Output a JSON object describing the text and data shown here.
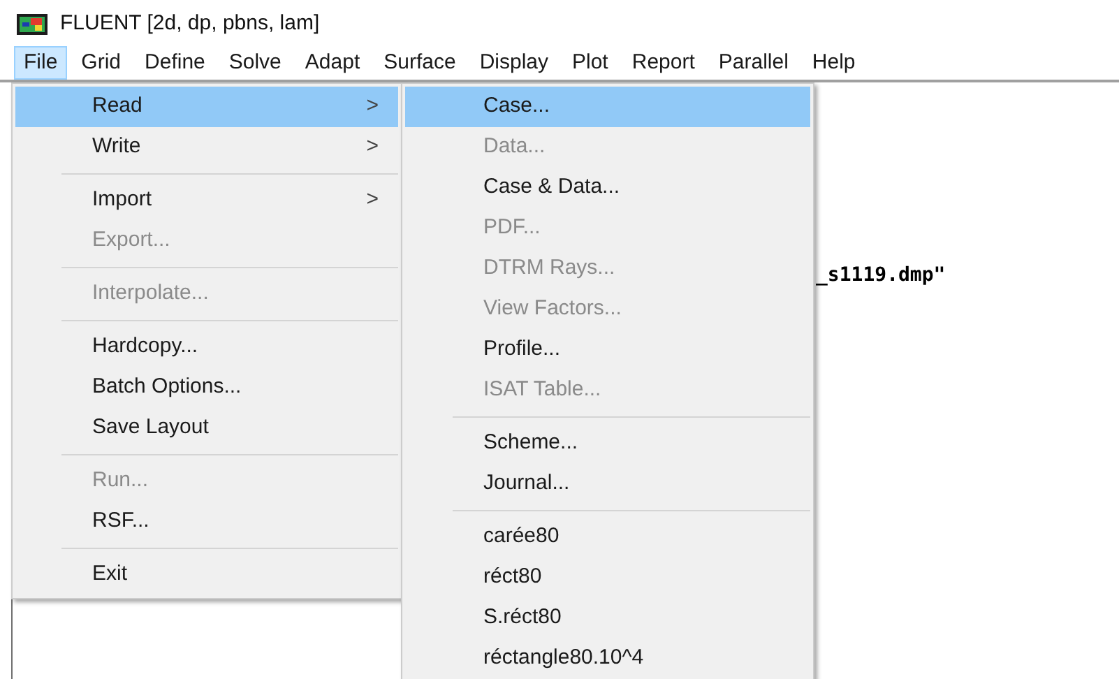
{
  "window": {
    "title": "FLUENT  [2d, dp, pbns, lam]"
  },
  "menubar": [
    {
      "label": "File",
      "selected": true
    },
    {
      "label": "Grid",
      "selected": false
    },
    {
      "label": "Define",
      "selected": false
    },
    {
      "label": "Solve",
      "selected": false
    },
    {
      "label": "Adapt",
      "selected": false
    },
    {
      "label": "Surface",
      "selected": false
    },
    {
      "label": "Display",
      "selected": false
    },
    {
      "label": "Plot",
      "selected": false
    },
    {
      "label": "Report",
      "selected": false
    },
    {
      "label": "Parallel",
      "selected": false
    },
    {
      "label": "Help",
      "selected": false
    }
  ],
  "console": {
    "text": "_s1119.dmp\""
  },
  "file_menu": [
    {
      "kind": "item",
      "label": "Read",
      "submenu": ">",
      "selected": true,
      "disabled": false
    },
    {
      "kind": "item",
      "label": "Write",
      "submenu": ">",
      "selected": false,
      "disabled": false
    },
    {
      "kind": "separator"
    },
    {
      "kind": "item",
      "label": "Import",
      "submenu": ">",
      "selected": false,
      "disabled": false
    },
    {
      "kind": "item",
      "label": "Export...",
      "selected": false,
      "disabled": true
    },
    {
      "kind": "separator"
    },
    {
      "kind": "item",
      "label": "Interpolate...",
      "selected": false,
      "disabled": true
    },
    {
      "kind": "separator"
    },
    {
      "kind": "item",
      "label": "Hardcopy...",
      "selected": false,
      "disabled": false
    },
    {
      "kind": "item",
      "label": "Batch Options...",
      "selected": false,
      "disabled": false
    },
    {
      "kind": "item",
      "label": "Save Layout",
      "selected": false,
      "disabled": false
    },
    {
      "kind": "separator"
    },
    {
      "kind": "item",
      "label": "Run...",
      "selected": false,
      "disabled": true
    },
    {
      "kind": "item",
      "label": "RSF...",
      "selected": false,
      "disabled": false
    },
    {
      "kind": "separator"
    },
    {
      "kind": "item",
      "label": "Exit",
      "selected": false,
      "disabled": false
    }
  ],
  "read_submenu": [
    {
      "kind": "item",
      "label": "Case...",
      "selected": true,
      "disabled": false
    },
    {
      "kind": "item",
      "label": "Data...",
      "selected": false,
      "disabled": true
    },
    {
      "kind": "item",
      "label": "Case & Data...",
      "selected": false,
      "disabled": false
    },
    {
      "kind": "item",
      "label": "PDF...",
      "selected": false,
      "disabled": true
    },
    {
      "kind": "item",
      "label": "DTRM Rays...",
      "selected": false,
      "disabled": true
    },
    {
      "kind": "item",
      "label": "View Factors...",
      "selected": false,
      "disabled": true
    },
    {
      "kind": "item",
      "label": "Profile...",
      "selected": false,
      "disabled": false
    },
    {
      "kind": "item",
      "label": "ISAT Table...",
      "selected": false,
      "disabled": true
    },
    {
      "kind": "separator"
    },
    {
      "kind": "item",
      "label": "Scheme...",
      "selected": false,
      "disabled": false
    },
    {
      "kind": "item",
      "label": "Journal...",
      "selected": false,
      "disabled": false
    },
    {
      "kind": "separator"
    },
    {
      "kind": "item",
      "label": "carée80",
      "selected": false,
      "disabled": false
    },
    {
      "kind": "item",
      "label": "réct80",
      "selected": false,
      "disabled": false
    },
    {
      "kind": "item",
      "label": "S.réct80",
      "selected": false,
      "disabled": false
    },
    {
      "kind": "item",
      "label": "réctangle80.10^4",
      "selected": false,
      "disabled": false
    }
  ]
}
